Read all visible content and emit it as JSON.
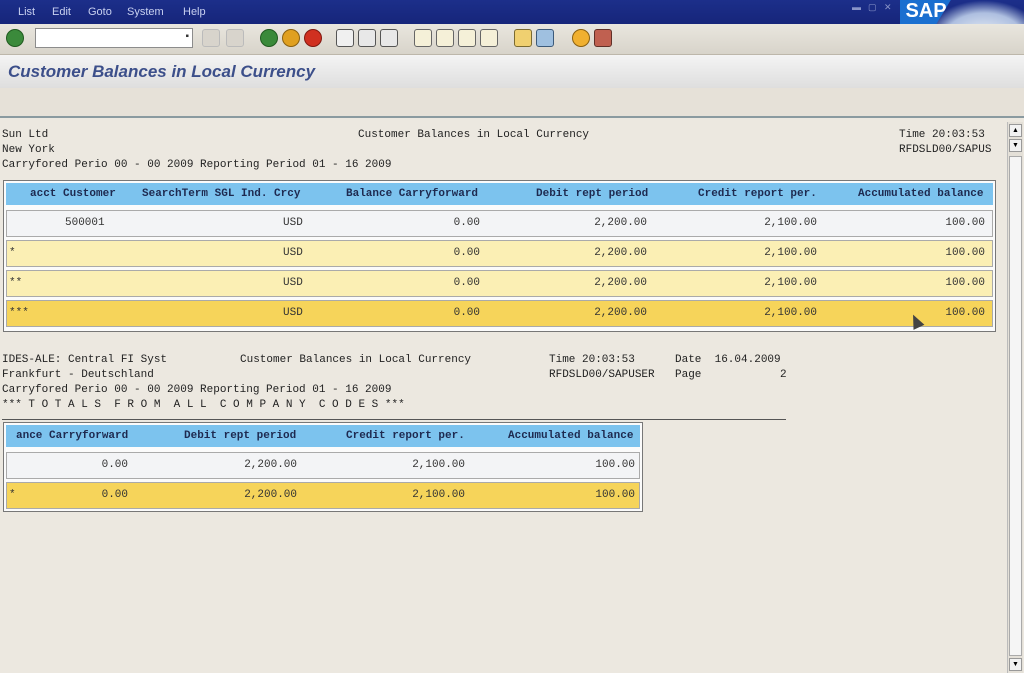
{
  "menubar": {
    "items": [
      "List",
      "Edit",
      "Goto",
      "System",
      "Help"
    ],
    "logo": "SAP"
  },
  "toolbar": {
    "command_field_value": "",
    "icons": [
      "enter-icon",
      "back-icon",
      "exit-icon",
      "cancel-icon",
      "print-icon",
      "find-icon",
      "find-next-icon",
      "first-page-icon",
      "prev-page-icon",
      "next-page-icon",
      "last-page-icon",
      "new-session-icon",
      "shortcut-icon",
      "help-icon",
      "layout-icon"
    ]
  },
  "title": "Customer Balances in Local Currency",
  "page1": {
    "company": "Sun Ltd",
    "city": "New York",
    "report_title": "Customer Balances in Local Currency",
    "time_label": "Time 20:03:53",
    "program_user": "RFDSLD00/SAPUS",
    "period_line": "Carryfored Perio 00 - 00 2009 Reporting Period 01 - 16 2009",
    "columns": [
      "acct Customer",
      "SearchTerm SGL Ind. Crcy",
      "Balance Carryforward",
      "Debit rept period",
      "Credit report per.",
      "Accumulated balance"
    ],
    "rows": [
      {
        "marker": "",
        "customer": "500001",
        "crcy": "USD",
        "carryforward": "0.00",
        "debit": "2,200.00",
        "credit": "2,100.00",
        "balance": "100.00"
      },
      {
        "marker": "*",
        "customer": "",
        "crcy": "USD",
        "carryforward": "0.00",
        "debit": "2,200.00",
        "credit": "2,100.00",
        "balance": "100.00"
      },
      {
        "marker": "**",
        "customer": "",
        "crcy": "USD",
        "carryforward": "0.00",
        "debit": "2,200.00",
        "credit": "2,100.00",
        "balance": "100.00"
      },
      {
        "marker": "***",
        "customer": "",
        "crcy": "USD",
        "carryforward": "0.00",
        "debit": "2,200.00",
        "credit": "2,100.00",
        "balance": "100.00"
      }
    ]
  },
  "page2": {
    "company": "IDES-ALE: Central FI Syst",
    "city": "Frankfurt - Deutschland",
    "report_title": "Customer Balances in Local Currency",
    "time_label": "Time 20:03:53",
    "date_label": "Date  16.04.2009",
    "program_user": "RFDSLD00/SAPUSER",
    "page_label": "Page",
    "page_number": "2",
    "period_line": "Carryfored Perio 00 - 00 2009 Reporting Period 01 - 16 2009",
    "totals_line": "*** T O T A L S  F R O M  A L L  C O M P A N Y  C O D E S ***",
    "columns": [
      "ance Carryforward",
      "Debit rept period",
      "Credit report per.",
      "Accumulated balance"
    ],
    "rows": [
      {
        "marker": "",
        "carryforward": "0.00",
        "debit": "2,200.00",
        "credit": "2,100.00",
        "balance": "100.00"
      },
      {
        "marker": "*",
        "carryforward": "0.00",
        "debit": "2,200.00",
        "credit": "2,100.00",
        "balance": "100.00"
      }
    ]
  }
}
